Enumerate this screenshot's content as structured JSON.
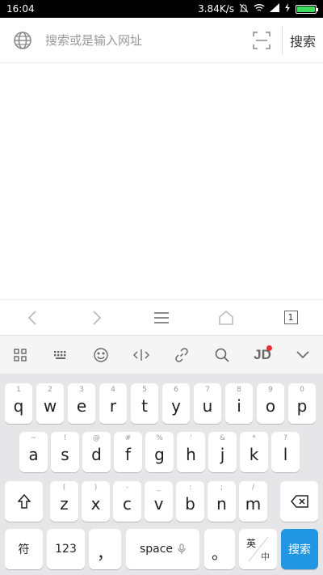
{
  "status_bar": {
    "time": "16:04",
    "net_speed": "3.84K/s",
    "battery_level": 1.0
  },
  "search": {
    "placeholder": "搜索或是输入网址",
    "button": "搜索"
  },
  "browser_nav": {
    "tab_count": "1"
  },
  "toolbar": {
    "jd_label": "JD"
  },
  "keyboard": {
    "row1": [
      {
        "main": "q",
        "sub": "1"
      },
      {
        "main": "w",
        "sub": "2"
      },
      {
        "main": "e",
        "sub": "3"
      },
      {
        "main": "r",
        "sub": "4"
      },
      {
        "main": "t",
        "sub": "5"
      },
      {
        "main": "y",
        "sub": "6"
      },
      {
        "main": "u",
        "sub": "7"
      },
      {
        "main": "i",
        "sub": "8"
      },
      {
        "main": "o",
        "sub": "9"
      },
      {
        "main": "p",
        "sub": "0"
      }
    ],
    "row2": [
      {
        "main": "a",
        "sub": "~"
      },
      {
        "main": "s",
        "sub": "!"
      },
      {
        "main": "d",
        "sub": "@"
      },
      {
        "main": "f",
        "sub": "#"
      },
      {
        "main": "g",
        "sub": "%"
      },
      {
        "main": "h",
        "sub": "'"
      },
      {
        "main": "j",
        "sub": "&"
      },
      {
        "main": "k",
        "sub": "*"
      },
      {
        "main": "l",
        "sub": "?"
      }
    ],
    "row3": [
      {
        "main": "z",
        "sub": "("
      },
      {
        "main": "x",
        "sub": ")"
      },
      {
        "main": "c",
        "sub": "-"
      },
      {
        "main": "v",
        "sub": "_"
      },
      {
        "main": "b",
        "sub": ":"
      },
      {
        "main": "n",
        "sub": ";"
      },
      {
        "main": "m",
        "sub": "/"
      }
    ],
    "symbols": "符",
    "numbers": "123",
    "comma": "，",
    "space": "space",
    "period": "。",
    "lang_main": "英",
    "lang_sub": "中",
    "enter": "搜索"
  },
  "colors": {
    "accent": "#2196e3",
    "battery": "#3ddc5b",
    "badge": "#e83030"
  }
}
